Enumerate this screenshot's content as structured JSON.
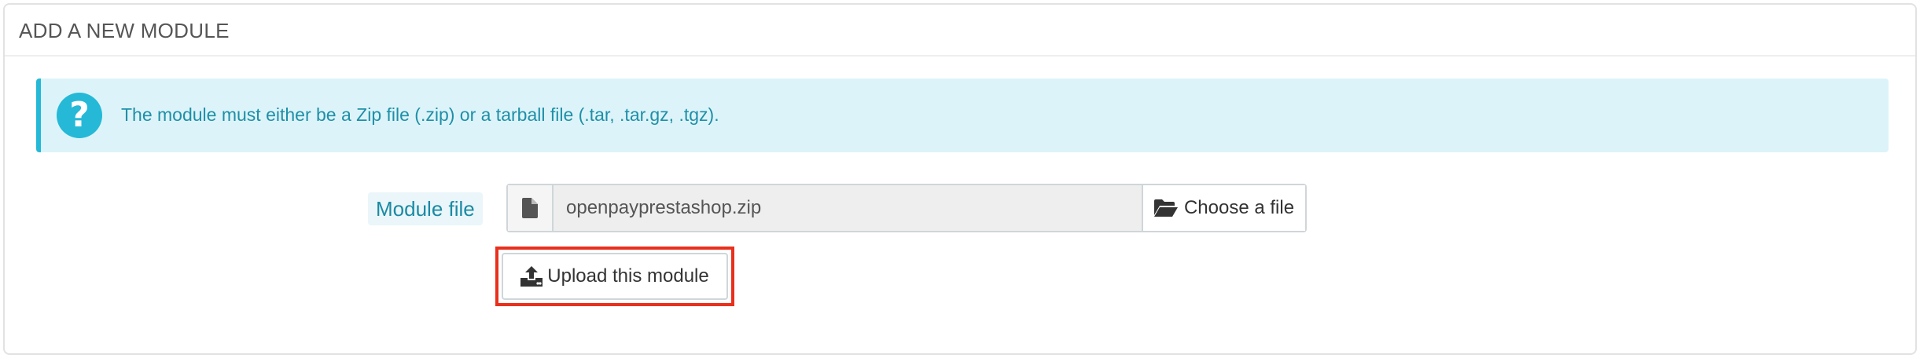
{
  "panel": {
    "title": "ADD A NEW MODULE"
  },
  "alert": {
    "icon": "question-circle-icon",
    "text": "The module must either be a Zip file (.zip) or a tarball file (.tar, .tar.gz, .tgz)."
  },
  "form": {
    "label": "Module file",
    "file_icon": "file-icon",
    "file_value": "openpayprestashop.zip",
    "choose_icon": "folder-open-icon",
    "choose_label": "Choose a file",
    "upload_icon": "upload-icon",
    "upload_label": "Upload this module"
  },
  "colors": {
    "accent": "#25b9d7",
    "alert_bg": "#dcf4f9",
    "highlight": "#e8301d"
  }
}
